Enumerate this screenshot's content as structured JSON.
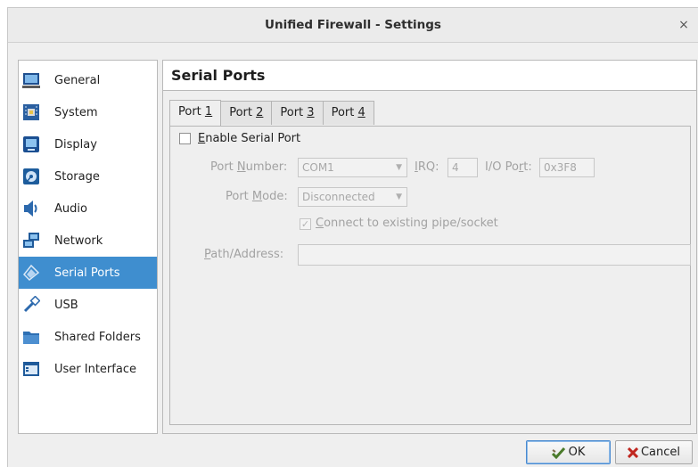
{
  "window": {
    "title": "Unified Firewall - Settings",
    "close_glyph": "×"
  },
  "sidebar": {
    "items": [
      {
        "label": "General",
        "icon": "general-icon"
      },
      {
        "label": "System",
        "icon": "system-icon"
      },
      {
        "label": "Display",
        "icon": "display-icon"
      },
      {
        "label": "Storage",
        "icon": "storage-icon"
      },
      {
        "label": "Audio",
        "icon": "audio-icon"
      },
      {
        "label": "Network",
        "icon": "network-icon"
      },
      {
        "label": "Serial Ports",
        "icon": "serial-ports-icon",
        "selected": true
      },
      {
        "label": "USB",
        "icon": "usb-icon"
      },
      {
        "label": "Shared Folders",
        "icon": "shared-folders-icon"
      },
      {
        "label": "User Interface",
        "icon": "user-interface-icon"
      }
    ]
  },
  "main": {
    "title": "Serial Ports",
    "tabs": [
      {
        "pre": "Port ",
        "key": "1"
      },
      {
        "pre": "Port ",
        "key": "2"
      },
      {
        "pre": "Port ",
        "key": "3"
      },
      {
        "pre": "Port ",
        "key": "4"
      }
    ],
    "active_tab": 0,
    "enable": {
      "key": "E",
      "rest": "nable Serial Port",
      "checked": false
    },
    "port_number": {
      "pre": "Port ",
      "key": "N",
      "post": "umber:",
      "value": "COM1"
    },
    "irq": {
      "key": "I",
      "post": "RQ:",
      "value": "4"
    },
    "io_port": {
      "pre": "I/O Po",
      "key": "r",
      "post": "t:",
      "value": "0x3F8"
    },
    "port_mode": {
      "pre": "Port ",
      "key": "M",
      "post": "ode:",
      "value": "Disconnected"
    },
    "connect": {
      "key": "C",
      "rest": "onnect to existing pipe/socket",
      "checked": true,
      "check_glyph": "✓"
    },
    "path": {
      "key": "P",
      "post": "ath/Address:",
      "value": ""
    }
  },
  "buttons": {
    "ok": {
      "label": "OK"
    },
    "cancel": {
      "label": "Cancel"
    }
  },
  "colors": {
    "selection": "#3f8ecf",
    "window_bg": "#efefef"
  }
}
